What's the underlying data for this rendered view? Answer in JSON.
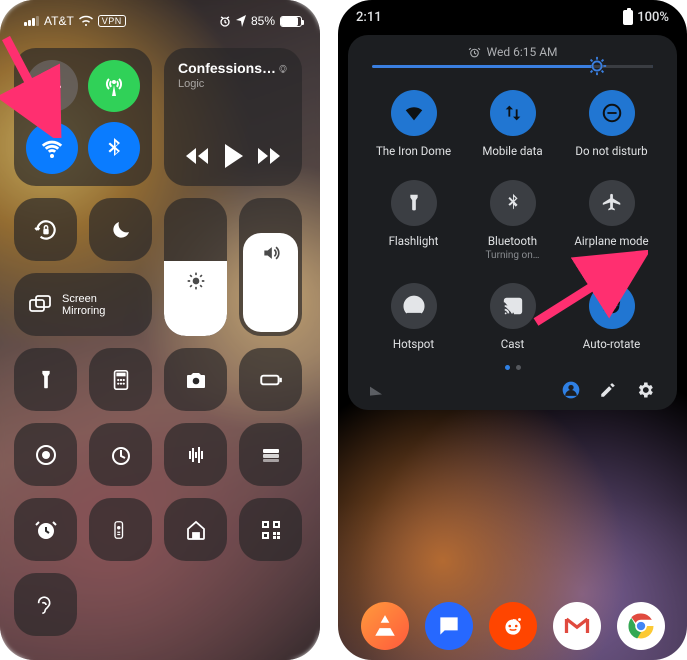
{
  "ios": {
    "status": {
      "carrier": "AT&T",
      "vpn": "VPN",
      "battery_pct": "85%"
    },
    "connectivity": {
      "airplane": {
        "on": false
      },
      "cellular": {
        "on": true
      },
      "wifi": {
        "on": true
      },
      "bluetooth": {
        "on": true
      }
    },
    "media": {
      "title": "Confessions of a...",
      "artist": "Logic"
    },
    "screen_mirroring_label": "Screen\nMirroring"
  },
  "android": {
    "status": {
      "time": "2:11",
      "battery_pct": "100%"
    },
    "alarm": "Wed 6:15 AM",
    "tiles": [
      {
        "name": "wifi",
        "label": "The Iron Dome",
        "on": true
      },
      {
        "name": "mobile-data",
        "label": "Mobile data",
        "on": true
      },
      {
        "name": "dnd",
        "label": "Do not disturb",
        "on": true
      },
      {
        "name": "flashlight",
        "label": "Flashlight",
        "on": false
      },
      {
        "name": "bluetooth",
        "label": "Bluetooth",
        "on": false,
        "sub": "Turning on…"
      },
      {
        "name": "airplane",
        "label": "Airplane mode",
        "on": false
      },
      {
        "name": "hotspot",
        "label": "Hotspot",
        "on": false
      },
      {
        "name": "cast",
        "label": "Cast",
        "on": false
      },
      {
        "name": "auto-rotate",
        "label": "Auto-rotate",
        "on": true
      }
    ],
    "brightness_pct": 78,
    "page_index": 0,
    "page_count": 2
  },
  "colors": {
    "ios_blue": "#0a7cff",
    "ios_green": "#30d158",
    "android_accent": "#2f80e4",
    "arrow": "#ff2f70"
  }
}
